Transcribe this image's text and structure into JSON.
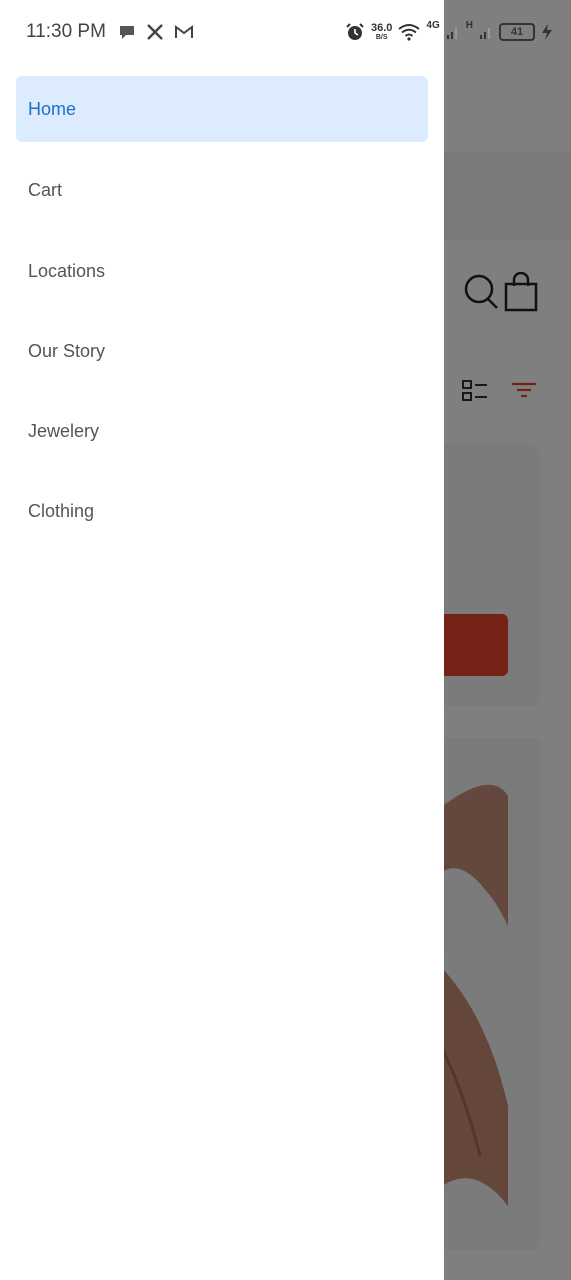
{
  "status_bar": {
    "time": "11:30 PM",
    "net_speed_value": "36.0",
    "net_speed_unit": "B/S",
    "network_label_1": "4G",
    "network_label_2": "H",
    "battery_level": "41",
    "notification_icons": [
      "chat-bubble-icon",
      "x-logo-icon",
      "gmail-icon"
    ],
    "right_icons": [
      "alarm-icon",
      "wifi-icon",
      "signal-icon",
      "signal-icon",
      "battery-icon",
      "charging-icon"
    ]
  },
  "drawer": {
    "items": [
      {
        "label": "Home",
        "active": true
      },
      {
        "label": "Cart",
        "active": false
      },
      {
        "label": "Locations",
        "active": false
      },
      {
        "label": "Our Story",
        "active": false
      },
      {
        "label": "Jewelery",
        "active": false
      },
      {
        "label": "Clothing",
        "active": false
      }
    ]
  },
  "colors": {
    "active_bg": "#dcebfd",
    "active_text": "#1a73c9",
    "item_text": "#555555",
    "accent": "#e8472c",
    "scrim": "rgba(0,0,0,0.5)"
  }
}
